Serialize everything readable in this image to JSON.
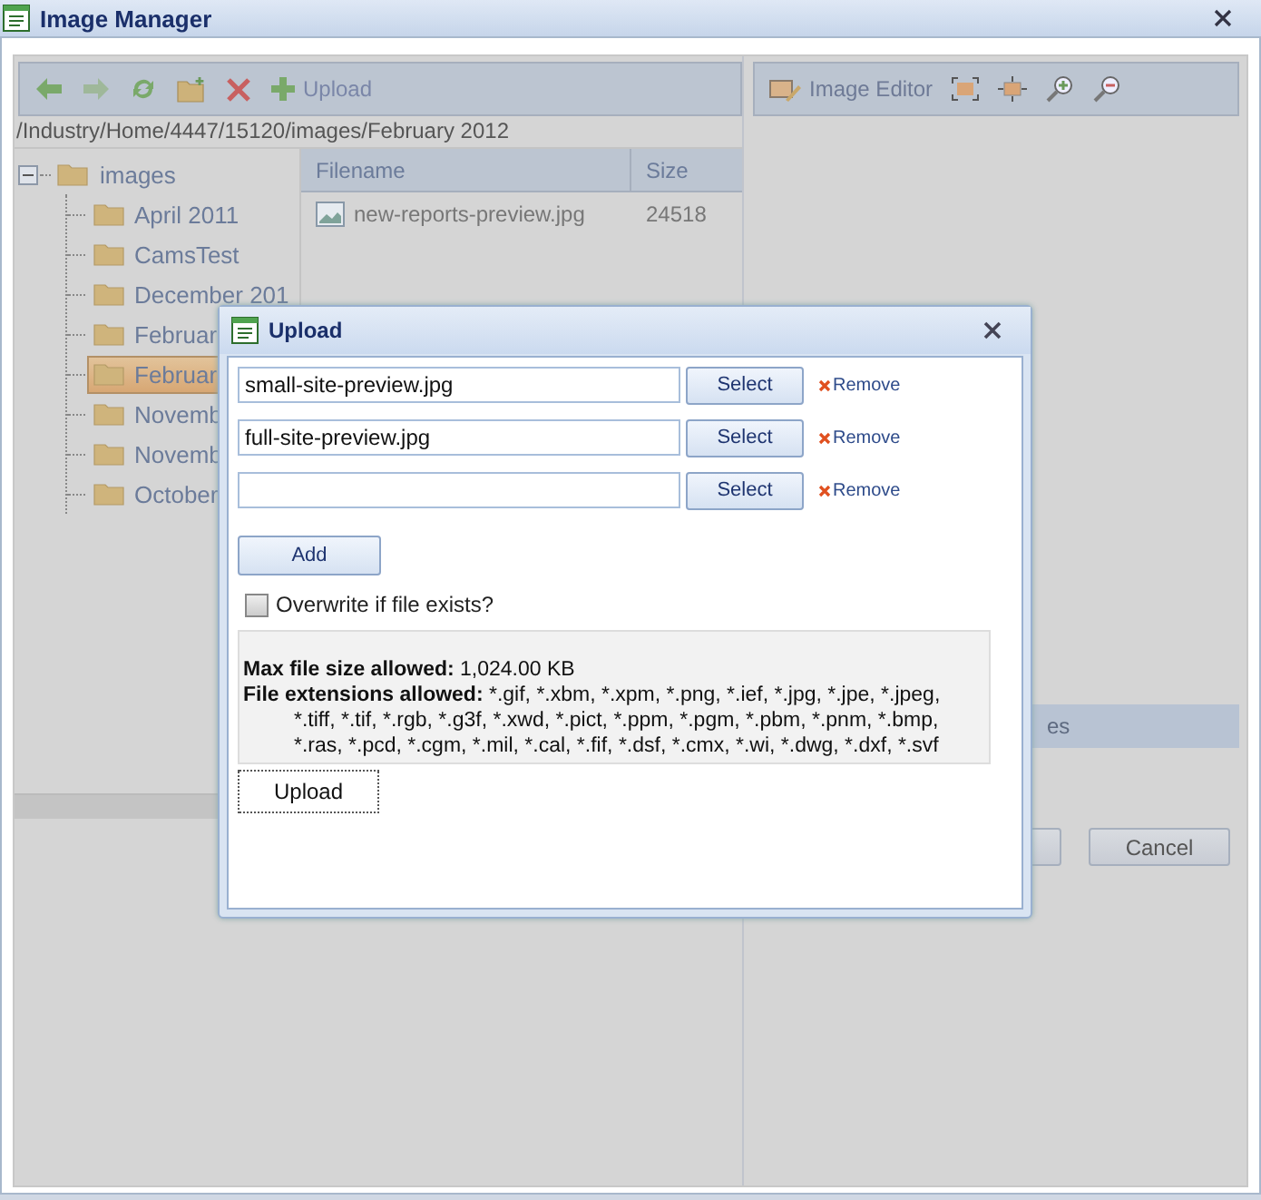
{
  "window": {
    "title": "Image Manager"
  },
  "left_toolbar": {
    "upload_label": "Upload"
  },
  "path": "/Industry/Home/4447/15120/images/February 2012",
  "tree": {
    "label": "images",
    "expanded": true,
    "children": [
      {
        "label": "April 2011",
        "selected": false
      },
      {
        "label": "CamsTest",
        "selected": false
      },
      {
        "label": "December 201",
        "selected": false
      },
      {
        "label": "Februar",
        "selected": false
      },
      {
        "label": "Februar",
        "selected": true
      },
      {
        "label": "Novemb",
        "selected": false
      },
      {
        "label": "Novemb",
        "selected": false
      },
      {
        "label": "October",
        "selected": false
      }
    ]
  },
  "file_list": {
    "columns": [
      "Filename",
      "Size"
    ],
    "rows": [
      {
        "filename": "new-reports-preview.jpg",
        "size": "24518"
      }
    ]
  },
  "right_toolbar": {
    "image_editor_label": "Image Editor"
  },
  "right_panel": {
    "section_label": "es",
    "cancel": "Cancel"
  },
  "upload_dialog": {
    "title": "Upload",
    "files": [
      {
        "value": "small-site-preview.jpg",
        "select": "Select",
        "remove": "Remove"
      },
      {
        "value": "full-site-preview.jpg",
        "select": "Select",
        "remove": "Remove"
      },
      {
        "select": "Select",
        "remove": "Remove"
      }
    ],
    "add": "Add",
    "overwrite": {
      "label": "Overwrite if file exists?",
      "checked": false
    },
    "max_size": {
      "label": "Max file size allowed:",
      "value": "1,024.00 KB"
    },
    "extensions": {
      "label": "File extensions allowed:",
      "value": "*.gif, *.xbm, *.xpm, *.png, *.ief, *.jpg, *.jpe, *.jpeg, *.tiff, *.tif, *.rgb, *.g3f, *.xwd, *.pict, *.ppm, *.pgm, *.pbm, *.pnm, *.bmp, *.ras, *.pcd, *.cgm, *.mil, *.cal, *.fif, *.dsf, *.cmx, *.wi, *.dwg, *.dxf, *.svf"
    },
    "upload": "Upload"
  }
}
